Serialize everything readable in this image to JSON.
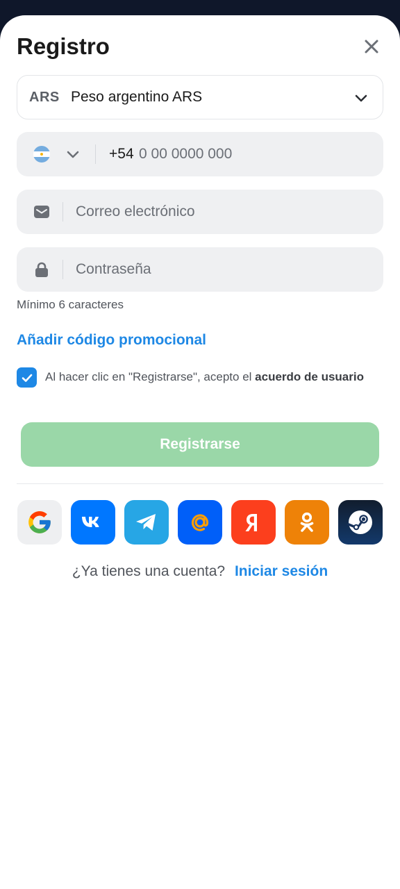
{
  "header": {
    "title": "Registro",
    "close_icon": "close-icon"
  },
  "currency": {
    "code": "ARS",
    "name": "Peso argentino ARS",
    "icon": "chevron-down-icon"
  },
  "phone": {
    "country_flag": "argentina-flag-icon",
    "prefix": "+54",
    "placeholder": "0 00 0000 000",
    "value": ""
  },
  "email": {
    "icon": "envelope-icon",
    "placeholder": "Correo electrónico",
    "value": ""
  },
  "password": {
    "icon": "lock-icon",
    "placeholder": "Contraseña",
    "value": "",
    "hint": "Mínimo 6 caracteres"
  },
  "promo": {
    "label": "Añadir código promocional"
  },
  "terms": {
    "checked": true,
    "text": "Al hacer clic en \"Registrarse\", acepto el ",
    "link": "acuerdo de usuario"
  },
  "submit": {
    "label": "Registrarse"
  },
  "social": {
    "providers": [
      {
        "name": "Google",
        "icon": "google-icon",
        "color": "#eeeff1"
      },
      {
        "name": "VK",
        "icon": "vk-icon",
        "color": "#0077ff"
      },
      {
        "name": "Telegram",
        "icon": "telegram-icon",
        "color": "#27a6e5"
      },
      {
        "name": "Mail.ru",
        "icon": "mail-ru-icon",
        "color": "#005ff9"
      },
      {
        "name": "Yandex",
        "icon": "yandex-icon",
        "color": "#fc3f1d"
      },
      {
        "name": "Odnoklassniki",
        "icon": "odnoklassniki-icon",
        "color": "#ee8208"
      },
      {
        "name": "Steam",
        "icon": "steam-icon",
        "color": "#13396b"
      }
    ]
  },
  "login": {
    "question": "¿Ya tienes una cuenta?",
    "link": "Iniciar sesión"
  },
  "colors": {
    "accent": "#1e88e5",
    "submit_disabled": "#9ad7a8",
    "field_bg": "#eff0f2"
  }
}
